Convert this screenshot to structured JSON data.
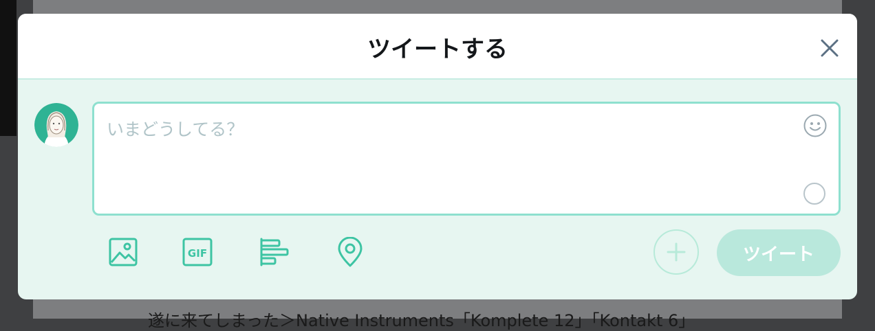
{
  "modal": {
    "title": "ツイートする"
  },
  "compose": {
    "placeholder": "いまどうしてる？",
    "value": ""
  },
  "toolbar": {
    "icons": [
      "image-icon",
      "gif-icon",
      "poll-icon",
      "location-icon"
    ],
    "gif_label": "GIF"
  },
  "actions": {
    "tweet_label": "ツイート"
  },
  "background": {
    "article_text": "遂に来てしまった＞Native Instruments「Komplete 12」「Kontakt 6」"
  },
  "colors": {
    "accent": "#3dc4a3",
    "accent_light": "#8ee0cf",
    "panel_bg": "#e7f6f1",
    "button_disabled": "#b9e8dc"
  }
}
